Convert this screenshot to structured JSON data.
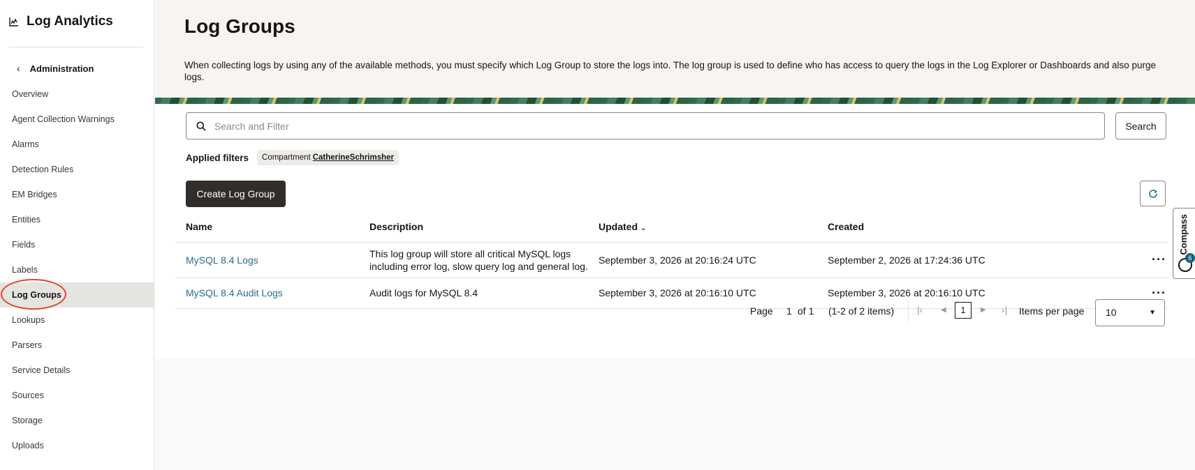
{
  "app": {
    "title": "Log Analytics",
    "icon": "chart-icon"
  },
  "sidebar": {
    "back_label": "Administration",
    "items": [
      {
        "label": "Overview"
      },
      {
        "label": "Agent Collection Warnings"
      },
      {
        "label": "Alarms"
      },
      {
        "label": "Detection Rules"
      },
      {
        "label": "EM Bridges"
      },
      {
        "label": "Entities"
      },
      {
        "label": "Fields"
      },
      {
        "label": "Labels"
      },
      {
        "label": "Log Groups",
        "active": true
      },
      {
        "label": "Lookups"
      },
      {
        "label": "Parsers"
      },
      {
        "label": "Service Details"
      },
      {
        "label": "Sources"
      },
      {
        "label": "Storage"
      },
      {
        "label": "Uploads"
      }
    ]
  },
  "page": {
    "title": "Log Groups",
    "description": "When collecting logs by using any of the available methods, you must specify which Log Group to store the logs into. The log group is used to define who has access to query the logs in the Log Explorer or Dashboards and also purge logs."
  },
  "search": {
    "placeholder": "Search and Filter",
    "value": "",
    "button": "Search"
  },
  "filters": {
    "label": "Applied filters",
    "chip_key": "Compartment",
    "chip_value": "CatherineSchrimsher"
  },
  "actions": {
    "create": "Create Log Group"
  },
  "table": {
    "headers": {
      "name": "Name",
      "description": "Description",
      "updated": "Updated",
      "created": "Created"
    },
    "rows": [
      {
        "name": "MySQL 8.4 Logs",
        "description_line1": "This log group will store all critical MySQL logs",
        "description_line2": "including error log, slow query log and general log.",
        "updated": "September 3, 2026 at 20:16:24 UTC",
        "created": "September 2, 2026 at 17:24:36 UTC"
      },
      {
        "name": "MySQL 8.4 Audit Logs",
        "description_line1": "Audit logs for MySQL 8.4",
        "updated": "September 3, 2026 at 20:16:10 UTC",
        "created": "September 3, 2026 at 20:16:10 UTC"
      }
    ]
  },
  "pager": {
    "page_label": "Page",
    "current": "1",
    "of_label": "of 1",
    "range": "(1-2 of 2 items)",
    "page_box": "1",
    "items_per_page_label": "Items per page",
    "items_per_page": "10"
  },
  "compass": {
    "label": "Compass",
    "count": "6"
  },
  "colors": {
    "link": "#2a6c8e",
    "primary_button": "#312d2a",
    "highlight_circle": "#e1462c"
  }
}
